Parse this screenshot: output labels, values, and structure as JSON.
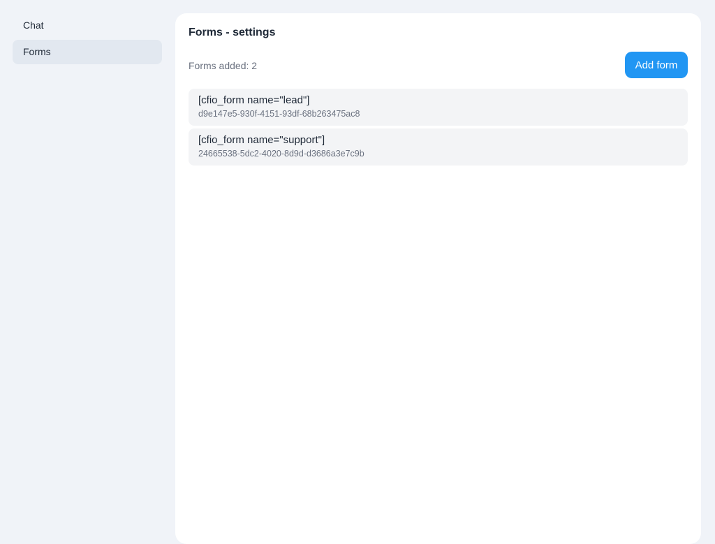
{
  "sidebar": {
    "items": [
      {
        "label": "Chat"
      },
      {
        "label": "Forms"
      }
    ]
  },
  "main": {
    "title": "Forms - settings",
    "count_text": "Forms added: 2",
    "add_button": "Add form",
    "forms": [
      {
        "name": "[cfio_form name=\"lead\"]",
        "id": "d9e147e5-930f-4151-93df-68b263475ac8"
      },
      {
        "name": "[cfio_form name=\"support\"]",
        "id": "24665538-5dc2-4020-8d9d-d3686a3e7c9b"
      }
    ]
  },
  "colors": {
    "accent": "#2196f3",
    "background": "#f0f3f8",
    "item_bg": "#f3f4f6"
  }
}
